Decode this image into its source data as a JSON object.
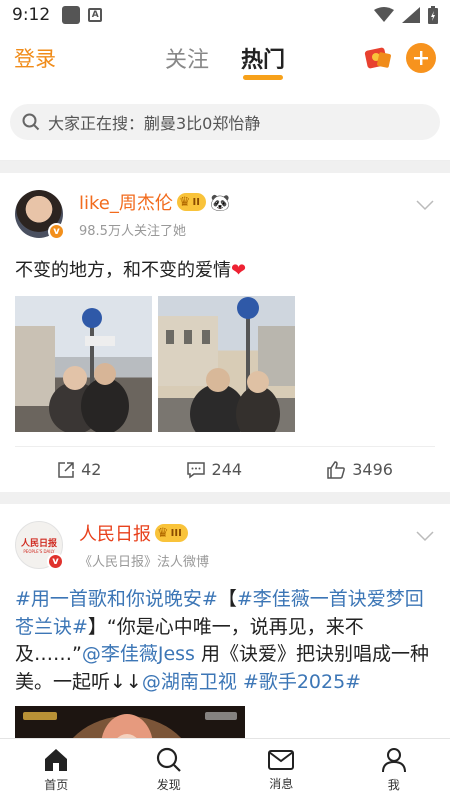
{
  "status": {
    "time": "9:12",
    "a_label": "A"
  },
  "header": {
    "login": "登录",
    "tabs": [
      {
        "label": "关注"
      },
      {
        "label": "热门"
      }
    ]
  },
  "search": {
    "text": "大家正在搜：蒯曼3比0郑怡静"
  },
  "posts": [
    {
      "name": "like_周杰伦",
      "badge": "II",
      "sub": "98.5万人关注了她",
      "text": "不变的地方，和不变的爱情",
      "actions": {
        "repost": "42",
        "comment": "244",
        "like": "3496"
      }
    },
    {
      "name": "人民日报",
      "badge": "III",
      "sub": "《人民日报》法人微博",
      "avatar_text": "人民日报",
      "avatar_sub": "PEOPLE'S DAILY",
      "text_parts": {
        "t1": "#用一首歌和你说晚安#",
        "t2": "【",
        "t3": "#李佳薇一首诀爱梦回苍兰诀#",
        "t4": "】“你是心中唯一，说再见，来不及……”",
        "t5": "@李佳薇Jess",
        "t6": " 用《诀爱》把诀别唱成一种美。一起听↓↓",
        "t7": "@湖南卫视",
        "t8": " ",
        "t9": "#歌手2025#"
      }
    }
  ],
  "nav": [
    {
      "label": "首页"
    },
    {
      "label": "发现"
    },
    {
      "label": "消息"
    },
    {
      "label": "我"
    }
  ],
  "colors": {
    "accent": "#f7931e",
    "link": "#3c76b6",
    "name": "#f26b1d"
  }
}
